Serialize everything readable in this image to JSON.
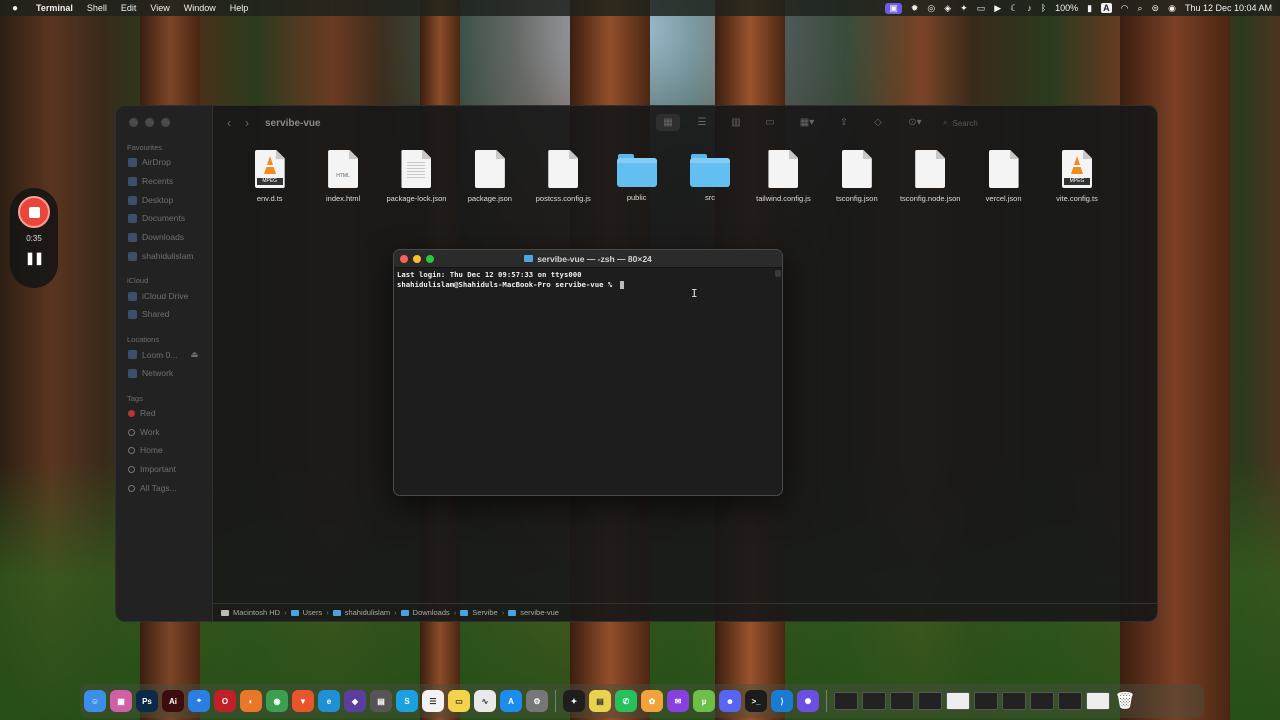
{
  "menubar": {
    "app": "Terminal",
    "menus": [
      "Shell",
      "Edit",
      "View",
      "Window",
      "Help"
    ],
    "battery": "100%",
    "input_source": "A",
    "datetime": "Thu 12 Dec  10:04 AM"
  },
  "recording": {
    "elapsed": "0:35",
    "pause_symbol": "❚❚"
  },
  "finder": {
    "folder_title": "servibe-vue",
    "search_placeholder": "Search",
    "sidebar": {
      "favourites_header": "Favourites",
      "favourites": [
        "AirDrop",
        "Recents",
        "Desktop",
        "Documents",
        "Downloads",
        "shahidulislam"
      ],
      "icloud_header": "iCloud",
      "icloud": [
        "iCloud Drive",
        "Shared"
      ],
      "locations_header": "Locations",
      "locations": [
        "Loom 0...",
        "Network"
      ],
      "tags_header": "Tags",
      "tags": [
        "Red",
        "Work",
        "Home",
        "Important",
        "All Tags..."
      ]
    },
    "files": [
      {
        "name": "env.d.ts",
        "kind": "vlc"
      },
      {
        "name": "index.html",
        "kind": "html",
        "badge": "HTML"
      },
      {
        "name": "package-lock.json",
        "kind": "lines"
      },
      {
        "name": "package.json",
        "kind": "doc"
      },
      {
        "name": "postcss.config.js",
        "kind": "doc"
      },
      {
        "name": "public",
        "kind": "folder"
      },
      {
        "name": "src",
        "kind": "folder"
      },
      {
        "name": "tailwind.config.js",
        "kind": "doc"
      },
      {
        "name": "tsconfig.json",
        "kind": "doc"
      },
      {
        "name": "tsconfig.node.json",
        "kind": "doc"
      },
      {
        "name": "vercel.json",
        "kind": "doc"
      },
      {
        "name": "vite.config.ts",
        "kind": "vlc"
      }
    ],
    "mpeg_badge": "MPEG",
    "path": [
      "Macintosh HD",
      "Users",
      "shahidulislam",
      "Downloads",
      "Servibe",
      "servibe-vue"
    ]
  },
  "terminal": {
    "title": "servibe-vue — -zsh — 80×24",
    "line1": "Last login: Thu Dec 12 09:57:33 on ttys000",
    "prompt": "shahidulislam@Shahiduls-MacBook-Pro servibe-vue % "
  },
  "dock": {
    "apps": [
      {
        "name": "finder",
        "color": "#3b8fe8",
        "glyph": "☺"
      },
      {
        "name": "launchpad",
        "color": "#d05fa5",
        "glyph": "▦"
      },
      {
        "name": "photoshop",
        "color": "#0b2a4a",
        "glyph": "Ps"
      },
      {
        "name": "illustrator",
        "color": "#3b0d0d",
        "glyph": "Ai"
      },
      {
        "name": "safari",
        "color": "#2a7de1",
        "glyph": "⌖"
      },
      {
        "name": "opera",
        "color": "#c0202a",
        "glyph": "O"
      },
      {
        "name": "firefox",
        "color": "#e8772a",
        "glyph": "◐"
      },
      {
        "name": "chrome",
        "color": "#3c9e4e",
        "glyph": "◉"
      },
      {
        "name": "brave",
        "color": "#e8552d",
        "glyph": "▼"
      },
      {
        "name": "edge",
        "color": "#1f8fd6",
        "glyph": "e"
      },
      {
        "name": "affinity",
        "color": "#5a3fa0",
        "glyph": "◆"
      },
      {
        "name": "calculator",
        "color": "#555555",
        "glyph": "▤"
      },
      {
        "name": "skype",
        "color": "#1ba0e0",
        "glyph": "S"
      },
      {
        "name": "reminders",
        "color": "#f2f2f2",
        "glyph": "☰"
      },
      {
        "name": "notes",
        "color": "#f3d34a",
        "glyph": "▭"
      },
      {
        "name": "freeform",
        "color": "#e9e9e9",
        "glyph": "∿"
      },
      {
        "name": "app-store",
        "color": "#1c8cf0",
        "glyph": "A"
      },
      {
        "name": "system-settings",
        "color": "#777777",
        "glyph": "⚙"
      },
      {
        "name": "figma",
        "color": "#1e1e1e",
        "glyph": "✦"
      },
      {
        "name": "stickies",
        "color": "#e8d24e",
        "glyph": "▤"
      },
      {
        "name": "whatsapp",
        "color": "#25c15b",
        "glyph": "✆"
      },
      {
        "name": "photos",
        "color": "#f0a33a",
        "glyph": "✿"
      },
      {
        "name": "messenger",
        "color": "#8a3fe0",
        "glyph": "✉"
      },
      {
        "name": "utorrent",
        "color": "#6cc04a",
        "glyph": "µ"
      },
      {
        "name": "discord",
        "color": "#5865f2",
        "glyph": "☻"
      },
      {
        "name": "terminal",
        "color": "#1c1c1c",
        "glyph": ">_"
      },
      {
        "name": "vscode",
        "color": "#1a7cd1",
        "glyph": "⟩"
      },
      {
        "name": "loom",
        "color": "#6a4fe0",
        "glyph": "✺"
      }
    ],
    "thumbnails": 10,
    "trash_glyph": "🗑"
  }
}
